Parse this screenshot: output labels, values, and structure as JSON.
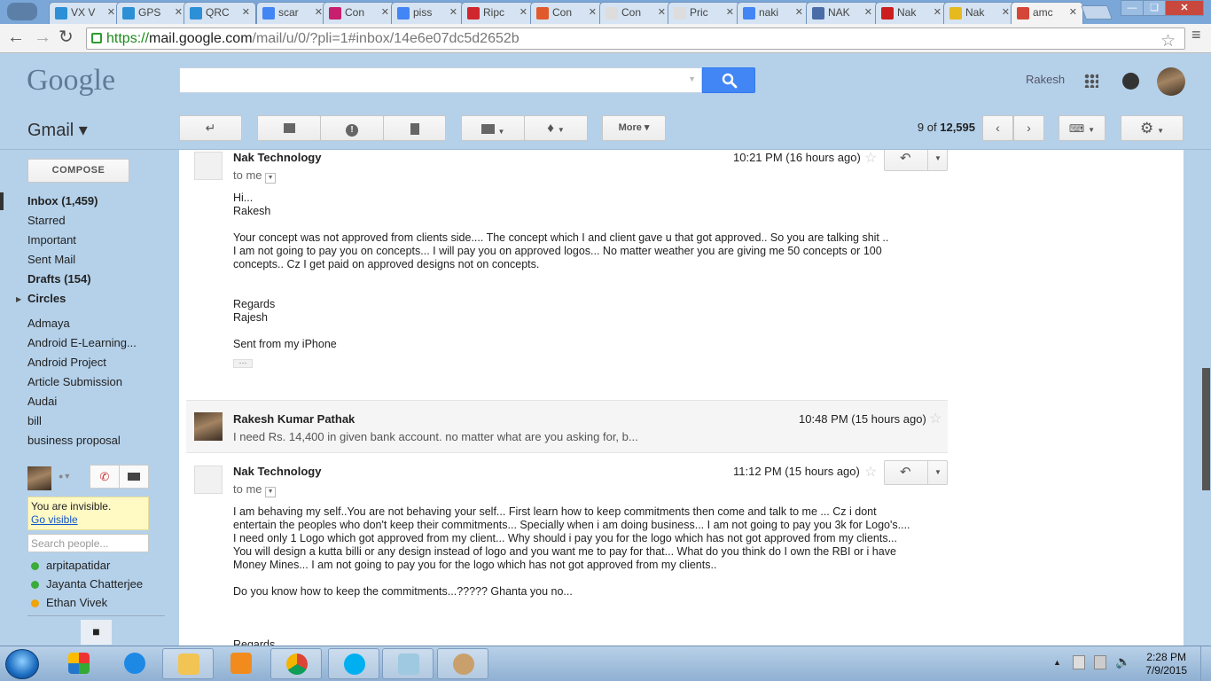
{
  "browser": {
    "tabs": [
      {
        "label": "VX V",
        "favicon_color": "#2d8fd5"
      },
      {
        "label": "GPS",
        "favicon_color": "#2d8fd5"
      },
      {
        "label": "QRC",
        "favicon_color": "#2d8fd5"
      },
      {
        "label": "scar",
        "favicon_color": "#4285f4"
      },
      {
        "label": "Con",
        "favicon_color": "#c81e6e"
      },
      {
        "label": "piss",
        "favicon_color": "#4285f4"
      },
      {
        "label": "Ripc",
        "favicon_color": "#d0262e"
      },
      {
        "label": "Con",
        "favicon_color": "#e05a2b"
      },
      {
        "label": "Con",
        "favicon_color": "#dddddd"
      },
      {
        "label": "Pric",
        "favicon_color": "#dddddd"
      },
      {
        "label": "naki",
        "favicon_color": "#4285f4"
      },
      {
        "label": "NAK",
        "favicon_color": "#4a6da7"
      },
      {
        "label": "Nak",
        "favicon_color": "#cc1e1e"
      },
      {
        "label": "Nak",
        "favicon_color": "#e6b91e"
      },
      {
        "label": "amc",
        "favicon_color": "#d44638"
      }
    ],
    "url_scheme": "https://",
    "url_domain": "mail.google.com",
    "url_path": "/mail/u/0/?pli=1#inbox/14e6e07dc5d2652b"
  },
  "header": {
    "logo": "Google",
    "user_name": "Rakesh"
  },
  "toolbar": {
    "app_label": "Gmail ▾",
    "more_label": "More ▾",
    "page_position": "9",
    "page_of": "of",
    "page_total": "12,595"
  },
  "sidebar": {
    "compose_label": "COMPOSE",
    "items": [
      {
        "label": "Inbox (1,459)",
        "bold": true
      },
      {
        "label": "Starred",
        "bold": false
      },
      {
        "label": "Important",
        "bold": false
      },
      {
        "label": "Sent Mail",
        "bold": false
      },
      {
        "label": "Drafts (154)",
        "bold": true
      },
      {
        "label": "Circles",
        "bold": true
      },
      {
        "label": "Admaya",
        "bold": false
      },
      {
        "label": "Android E-Learning...",
        "bold": false
      },
      {
        "label": "Android Project",
        "bold": false
      },
      {
        "label": "Article Submission",
        "bold": false
      },
      {
        "label": "Audai",
        "bold": false
      },
      {
        "label": "bill",
        "bold": false
      },
      {
        "label": "business proposal",
        "bold": false
      }
    ],
    "chat": {
      "invisible_text": "You are invisible.",
      "go_visible": "Go visible",
      "search_placeholder": "Search people...",
      "contacts": [
        {
          "name": "arpitapatidar",
          "status_color": "#3bab3b"
        },
        {
          "name": "Jayanta Chatterjee",
          "status_color": "#3bab3b"
        },
        {
          "name": "Ethan Vivek",
          "status_color": "#f0a30a"
        }
      ]
    }
  },
  "messages": {
    "m1": {
      "sender": "Nak Technology",
      "to": "to me",
      "time": "10:21 PM (16 hours ago)",
      "body": "Hi...\nRakesh\n\nYour concept was not approved from clients side.... The concept which I and client gave u that got approved.. So you are talking shit ..\nI am not going to pay you on concepts... I will pay you on approved logos... No matter weather you are giving me 50 concepts or 100\nconcepts.. Cz I get paid on approved designs not on concepts.\n\n\nRegards\nRajesh\n\nSent from my iPhone",
      "ellipsis": "···"
    },
    "m2": {
      "sender": "Rakesh Kumar Pathak",
      "time": "10:48 PM (15 hours ago)",
      "snippet": "I need Rs. 14,400 in given bank account. no matter what are you asking for, b..."
    },
    "m3": {
      "sender": "Nak Technology",
      "to": "to me",
      "time": "11:12 PM (15 hours ago)",
      "body": "I am behaving my self..You are not behaving your self... First learn how to keep commitments then come and talk to me ... Cz i dont\nentertain the peoples who don't keep their commitments... Specially when i am doing business... I am not going to pay you 3k for Logo's....\nI need only 1 Logo which got approved from my client... Why should i pay you for the logo which has not got approved from my clients...\nYou will design a kutta billi or any design instead of logo and you want me to pay for that... What do you think do I own the RBI or i have\nMoney Mines... I am not going to pay you for the logo which has not got approved from my clients..\n\nDo you know how to keep the commitments...????? Ghanta you no...\n\n\n\nRegards"
    }
  },
  "taskbar": {
    "time": "2:28 PM",
    "date": "7/9/2015"
  }
}
